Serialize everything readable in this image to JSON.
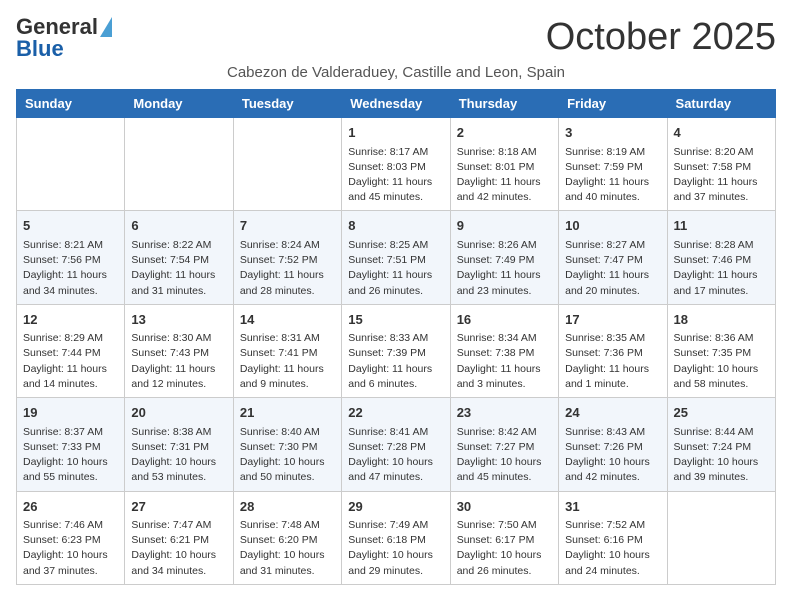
{
  "header": {
    "logo_general": "General",
    "logo_blue": "Blue",
    "month_title": "October 2025",
    "subtitle": "Cabezon de Valderaduey, Castille and Leon, Spain"
  },
  "days_of_week": [
    "Sunday",
    "Monday",
    "Tuesday",
    "Wednesday",
    "Thursday",
    "Friday",
    "Saturday"
  ],
  "weeks": [
    [
      {
        "day": "",
        "info": ""
      },
      {
        "day": "",
        "info": ""
      },
      {
        "day": "",
        "info": ""
      },
      {
        "day": "1",
        "info": "Sunrise: 8:17 AM\nSunset: 8:03 PM\nDaylight: 11 hours and 45 minutes."
      },
      {
        "day": "2",
        "info": "Sunrise: 8:18 AM\nSunset: 8:01 PM\nDaylight: 11 hours and 42 minutes."
      },
      {
        "day": "3",
        "info": "Sunrise: 8:19 AM\nSunset: 7:59 PM\nDaylight: 11 hours and 40 minutes."
      },
      {
        "day": "4",
        "info": "Sunrise: 8:20 AM\nSunset: 7:58 PM\nDaylight: 11 hours and 37 minutes."
      }
    ],
    [
      {
        "day": "5",
        "info": "Sunrise: 8:21 AM\nSunset: 7:56 PM\nDaylight: 11 hours and 34 minutes."
      },
      {
        "day": "6",
        "info": "Sunrise: 8:22 AM\nSunset: 7:54 PM\nDaylight: 11 hours and 31 minutes."
      },
      {
        "day": "7",
        "info": "Sunrise: 8:24 AM\nSunset: 7:52 PM\nDaylight: 11 hours and 28 minutes."
      },
      {
        "day": "8",
        "info": "Sunrise: 8:25 AM\nSunset: 7:51 PM\nDaylight: 11 hours and 26 minutes."
      },
      {
        "day": "9",
        "info": "Sunrise: 8:26 AM\nSunset: 7:49 PM\nDaylight: 11 hours and 23 minutes."
      },
      {
        "day": "10",
        "info": "Sunrise: 8:27 AM\nSunset: 7:47 PM\nDaylight: 11 hours and 20 minutes."
      },
      {
        "day": "11",
        "info": "Sunrise: 8:28 AM\nSunset: 7:46 PM\nDaylight: 11 hours and 17 minutes."
      }
    ],
    [
      {
        "day": "12",
        "info": "Sunrise: 8:29 AM\nSunset: 7:44 PM\nDaylight: 11 hours and 14 minutes."
      },
      {
        "day": "13",
        "info": "Sunrise: 8:30 AM\nSunset: 7:43 PM\nDaylight: 11 hours and 12 minutes."
      },
      {
        "day": "14",
        "info": "Sunrise: 8:31 AM\nSunset: 7:41 PM\nDaylight: 11 hours and 9 minutes."
      },
      {
        "day": "15",
        "info": "Sunrise: 8:33 AM\nSunset: 7:39 PM\nDaylight: 11 hours and 6 minutes."
      },
      {
        "day": "16",
        "info": "Sunrise: 8:34 AM\nSunset: 7:38 PM\nDaylight: 11 hours and 3 minutes."
      },
      {
        "day": "17",
        "info": "Sunrise: 8:35 AM\nSunset: 7:36 PM\nDaylight: 11 hours and 1 minute."
      },
      {
        "day": "18",
        "info": "Sunrise: 8:36 AM\nSunset: 7:35 PM\nDaylight: 10 hours and 58 minutes."
      }
    ],
    [
      {
        "day": "19",
        "info": "Sunrise: 8:37 AM\nSunset: 7:33 PM\nDaylight: 10 hours and 55 minutes."
      },
      {
        "day": "20",
        "info": "Sunrise: 8:38 AM\nSunset: 7:31 PM\nDaylight: 10 hours and 53 minutes."
      },
      {
        "day": "21",
        "info": "Sunrise: 8:40 AM\nSunset: 7:30 PM\nDaylight: 10 hours and 50 minutes."
      },
      {
        "day": "22",
        "info": "Sunrise: 8:41 AM\nSunset: 7:28 PM\nDaylight: 10 hours and 47 minutes."
      },
      {
        "day": "23",
        "info": "Sunrise: 8:42 AM\nSunset: 7:27 PM\nDaylight: 10 hours and 45 minutes."
      },
      {
        "day": "24",
        "info": "Sunrise: 8:43 AM\nSunset: 7:26 PM\nDaylight: 10 hours and 42 minutes."
      },
      {
        "day": "25",
        "info": "Sunrise: 8:44 AM\nSunset: 7:24 PM\nDaylight: 10 hours and 39 minutes."
      }
    ],
    [
      {
        "day": "26",
        "info": "Sunrise: 7:46 AM\nSunset: 6:23 PM\nDaylight: 10 hours and 37 minutes."
      },
      {
        "day": "27",
        "info": "Sunrise: 7:47 AM\nSunset: 6:21 PM\nDaylight: 10 hours and 34 minutes."
      },
      {
        "day": "28",
        "info": "Sunrise: 7:48 AM\nSunset: 6:20 PM\nDaylight: 10 hours and 31 minutes."
      },
      {
        "day": "29",
        "info": "Sunrise: 7:49 AM\nSunset: 6:18 PM\nDaylight: 10 hours and 29 minutes."
      },
      {
        "day": "30",
        "info": "Sunrise: 7:50 AM\nSunset: 6:17 PM\nDaylight: 10 hours and 26 minutes."
      },
      {
        "day": "31",
        "info": "Sunrise: 7:52 AM\nSunset: 6:16 PM\nDaylight: 10 hours and 24 minutes."
      },
      {
        "day": "",
        "info": ""
      }
    ]
  ]
}
